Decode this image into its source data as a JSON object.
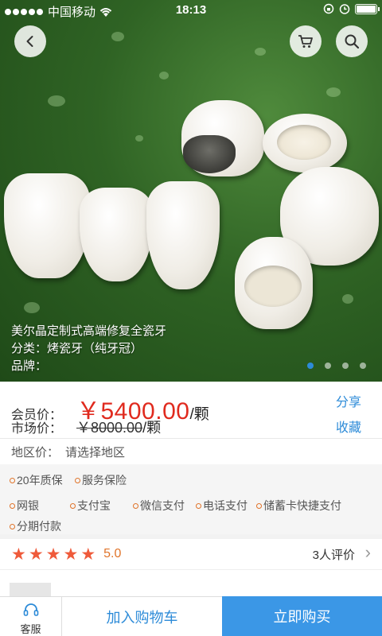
{
  "status_bar": {
    "carrier": "中国移动",
    "time": "18:13",
    "signal_dots": 5,
    "battery_level": 1.0
  },
  "nav": {
    "back_icon": "chevron-left-icon",
    "cart_icon": "shopping-cart-icon",
    "search_icon": "search-icon"
  },
  "product": {
    "title": "美尔晶定制式高端修复全瓷牙",
    "category": "分类：烤瓷牙（纯牙冠）",
    "brand": "品牌："
  },
  "carousel": {
    "count": 4,
    "active_index": 0
  },
  "pricing": {
    "member_label": "会员价：",
    "member_price": "￥5400.00",
    "member_unit": "/颗",
    "market_label": "市场价：",
    "market_price": "￥8000.00",
    "market_unit": "/颗",
    "share": "分享",
    "favorite": "收藏"
  },
  "region": {
    "label": "地区价：",
    "value": "请选择地区"
  },
  "tags": {
    "warranty": "20年质保",
    "insurance": "服务保险",
    "payments": [
      "网银",
      "支付宝",
      "微信支付",
      "电话支付",
      "储蓄卡快捷支付",
      "分期付款"
    ]
  },
  "rating": {
    "stars": 5,
    "score": "5.0",
    "reviews": "3人评价"
  },
  "bottom_bar": {
    "service": "客服",
    "add_to_cart": "加入购物车",
    "buy_now": "立即购买"
  },
  "colors": {
    "accent": "#3b97e6",
    "price_red": "#e02a1e",
    "star": "#ef5a3a",
    "link_blue": "#2d8bd8"
  }
}
